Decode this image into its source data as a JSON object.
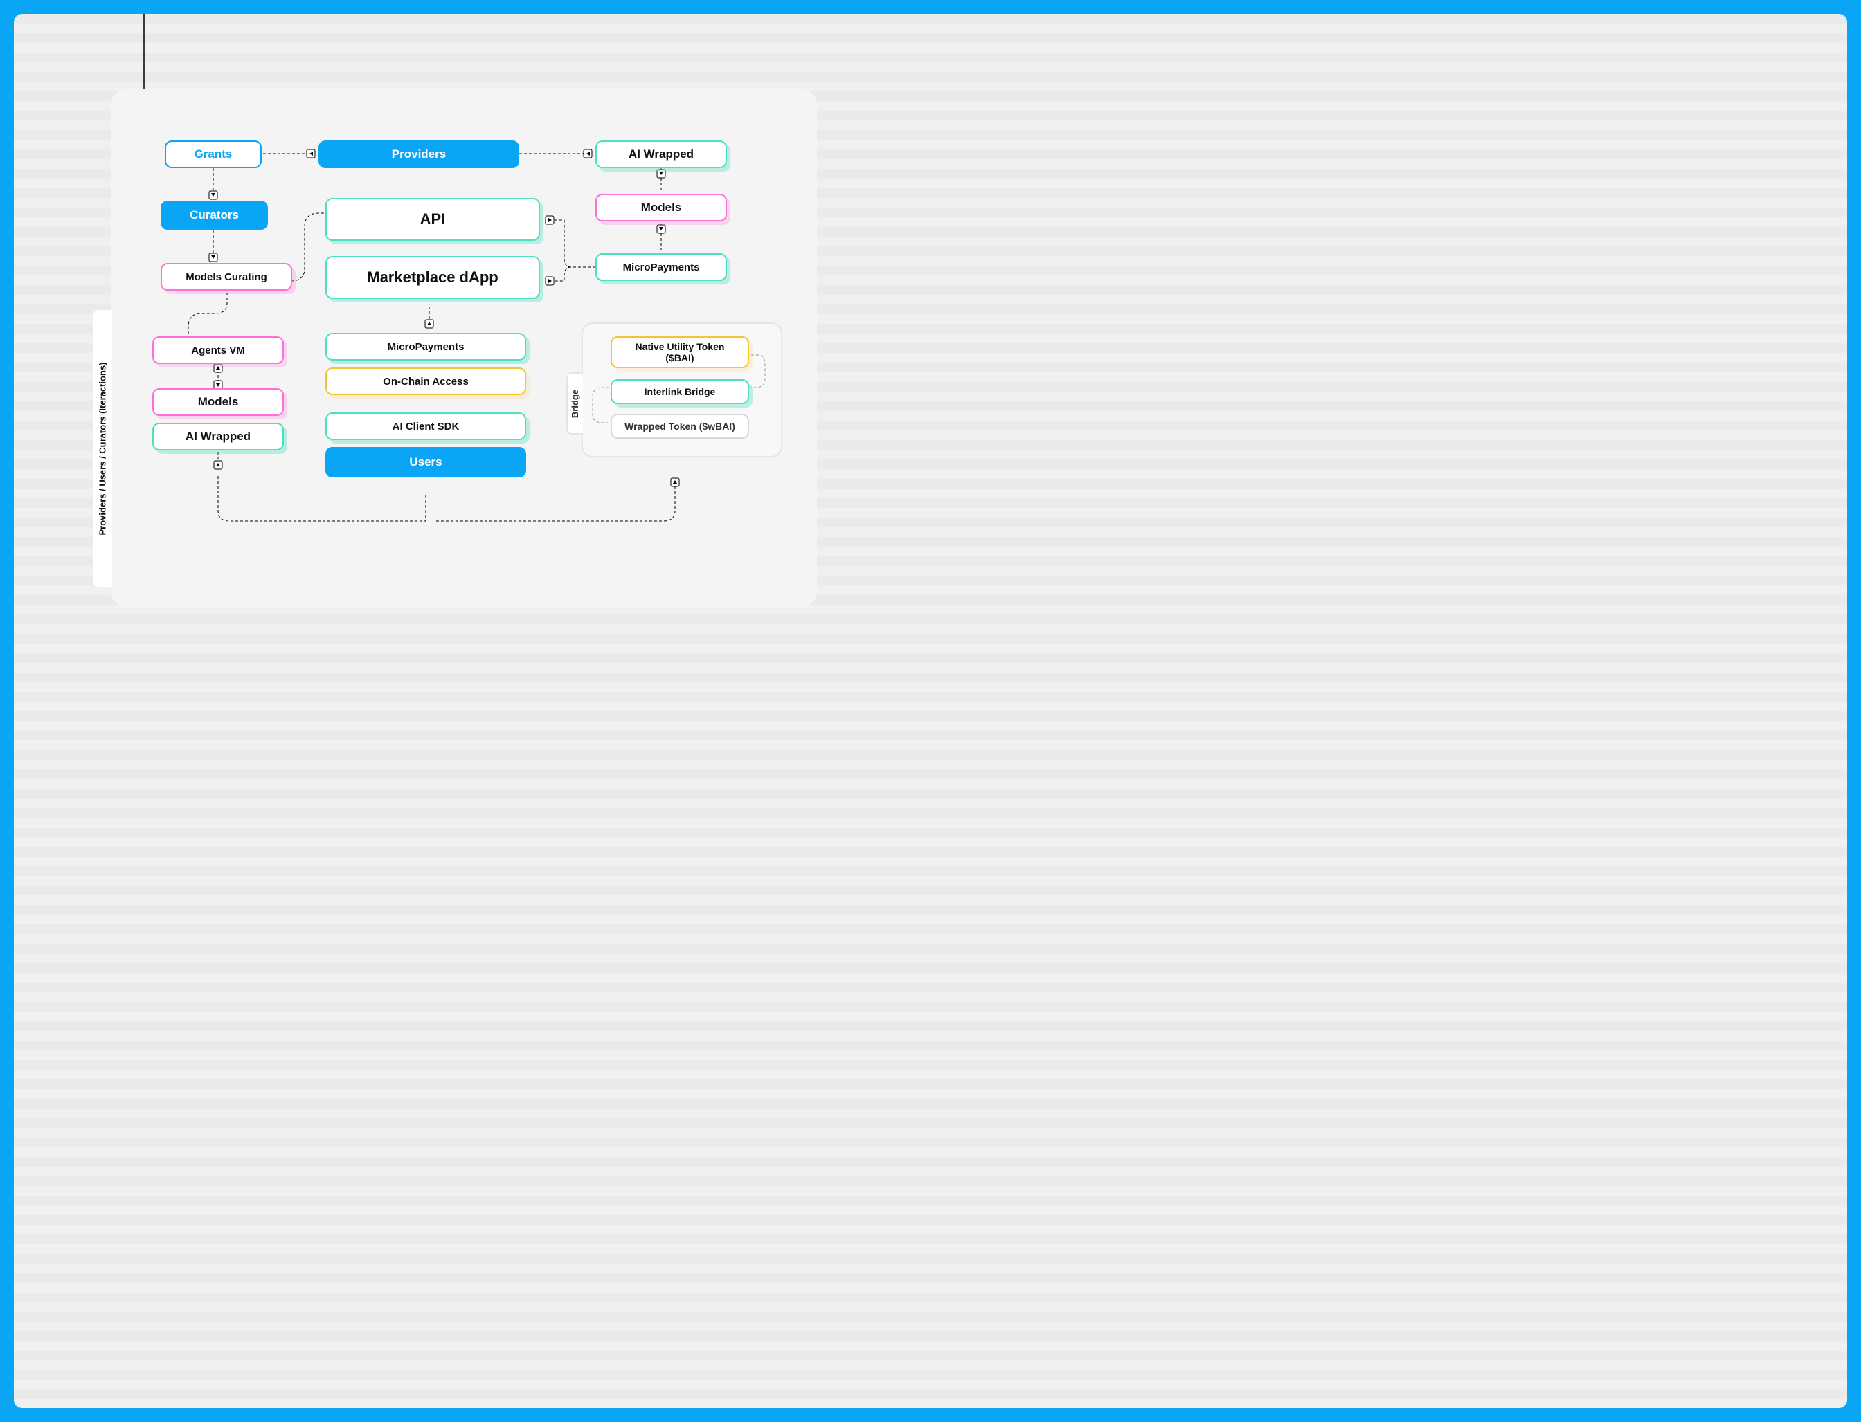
{
  "side_label": "Providers / Users / Curators  (Iteractions)",
  "nodes": {
    "grants": "Grants",
    "providers": "Providers",
    "ai_wrapped_top": "AI Wrapped",
    "curators": "Curators",
    "models_top": "Models",
    "models_curating": "Models Curating",
    "micropayments_right": "MicroPayments",
    "api": "API",
    "marketplace": "Marketplace dApp",
    "agents_vm": "Agents VM",
    "models_left": "Models",
    "ai_wrapped_left": "AI Wrapped",
    "micropayments_center": "MicroPayments",
    "onchain_access": "On-Chain Access",
    "ai_client_sdk": "AI Client SDK",
    "users": "Users",
    "bridge_label": "Bridge",
    "native_token": "Native Utility Token ($BAI)",
    "interlink_bridge": "Interlink Bridge",
    "wrapped_token": "Wrapped Token ($wBAI)"
  }
}
